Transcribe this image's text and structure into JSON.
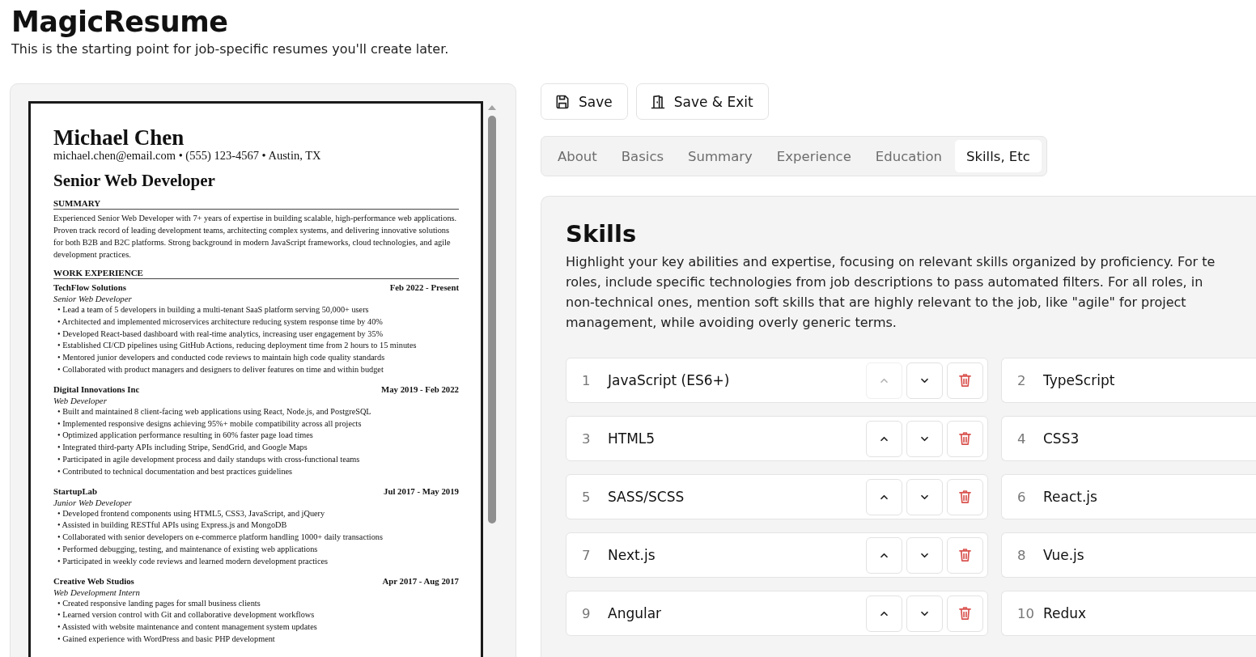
{
  "header": {
    "title": "MagicResume",
    "subtitle": "This is the starting point for job-specific resumes you'll create later."
  },
  "resume": {
    "name": "Michael Chen",
    "contact": "michael.chen@email.com • (555) 123-4567 • Austin, TX",
    "headline": "Senior Web Developer",
    "sections": [
      {
        "kind": "text",
        "title": "SUMMARY",
        "text": "Experienced Senior Web Developer with 7+ years of expertise in building scalable, high-performance web applications. Proven track record of leading development teams, architecting complex systems, and delivering innovative solutions for both B2B and B2C platforms. Strong background in modern JavaScript frameworks, cloud technologies, and agile development practices."
      },
      {
        "kind": "jobs",
        "title": "WORK EXPERIENCE",
        "jobs": [
          {
            "company": "TechFlow Solutions",
            "dates": "Feb 2022 - Present",
            "role": "Senior Web Developer",
            "bullets": [
              "• Lead a team of 5 developers in building a multi-tenant SaaS platform serving 50,000+ users",
              "• Architected and implemented microservices architecture reducing system response time by 40%",
              "• Developed React-based dashboard with real-time analytics, increasing user engagement by 35%",
              "• Established CI/CD pipelines using GitHub Actions, reducing deployment time from 2 hours to 15 minutes",
              "• Mentored junior developers and conducted code reviews to maintain high code quality standards",
              "• Collaborated with product managers and designers to deliver features on time and within budget"
            ]
          },
          {
            "company": "Digital Innovations Inc",
            "dates": "May 2019 - Feb 2022",
            "role": "Web Developer",
            "bullets": [
              "• Built and maintained 8 client-facing web applications using React, Node.js, and PostgreSQL",
              "• Implemented responsive designs achieving 95%+ mobile compatibility across all projects",
              "• Optimized application performance resulting in 60% faster page load times",
              "• Integrated third-party APIs including Stripe, SendGrid, and Google Maps",
              "• Participated in agile development process and daily standups with cross-functional teams",
              "• Contributed to technical documentation and best practices guidelines"
            ]
          },
          {
            "company": "StartupLab",
            "dates": "Jul 2017 - May 2019",
            "role": "Junior Web Developer",
            "bullets": [
              "• Developed frontend components using HTML5, CSS3, JavaScript, and jQuery",
              "• Assisted in building RESTful APIs using Express.js and MongoDB",
              "• Collaborated with senior developers on e-commerce platform handling 1000+ daily transactions",
              "• Performed debugging, testing, and maintenance of existing web applications",
              "• Participated in weekly code reviews and learned modern development practices"
            ]
          },
          {
            "company": "Creative Web Studios",
            "dates": "Apr 2017 - Aug 2017",
            "role": "Web Development Intern",
            "bullets": [
              "• Created responsive landing pages for small business clients",
              "• Learned version control with Git and collaborative development workflows",
              "• Assisted with website maintenance and content management system updates",
              "• Gained experience with WordPress and basic PHP development"
            ]
          }
        ]
      }
    ]
  },
  "actions": [
    {
      "kind": "save",
      "label": "Save"
    },
    {
      "kind": "exit",
      "label": "Save & Exit"
    }
  ],
  "tabs": [
    {
      "label": "About",
      "selected": false
    },
    {
      "label": "Basics",
      "selected": false
    },
    {
      "label": "Summary",
      "selected": false
    },
    {
      "label": "Experience",
      "selected": false
    },
    {
      "label": "Education",
      "selected": false
    },
    {
      "label": "Skills, Etc",
      "selected": true
    }
  ],
  "skills": {
    "title": "Skills",
    "description_lines": [
      "Highlight your key abilities and expertise, focusing on relevant skills organized by proficiency. For te",
      "roles, include specific technologies from job descriptions to pass automated filters. For all roles, in",
      "non-technical ones, mention soft skills that are highly relevant to the job, like \"agile\" for project",
      "management, while avoiding overly generic terms."
    ],
    "rows": [
      {
        "left": {
          "number": "1",
          "name": "JavaScript (ES6+)",
          "up_disabled": true
        },
        "right": {
          "number": "2",
          "name": "TypeScript"
        }
      },
      {
        "left": {
          "number": "3",
          "name": "HTML5",
          "up_disabled": false
        },
        "right": {
          "number": "4",
          "name": "CSS3"
        }
      },
      {
        "left": {
          "number": "5",
          "name": "SASS/SCSS",
          "up_disabled": false
        },
        "right": {
          "number": "6",
          "name": "React.js"
        }
      },
      {
        "left": {
          "number": "7",
          "name": "Next.js",
          "up_disabled": false
        },
        "right": {
          "number": "8",
          "name": "Vue.js"
        }
      },
      {
        "left": {
          "number": "9",
          "name": "Angular",
          "up_disabled": false
        },
        "right": {
          "number": "10",
          "name": "Redux"
        }
      }
    ]
  }
}
